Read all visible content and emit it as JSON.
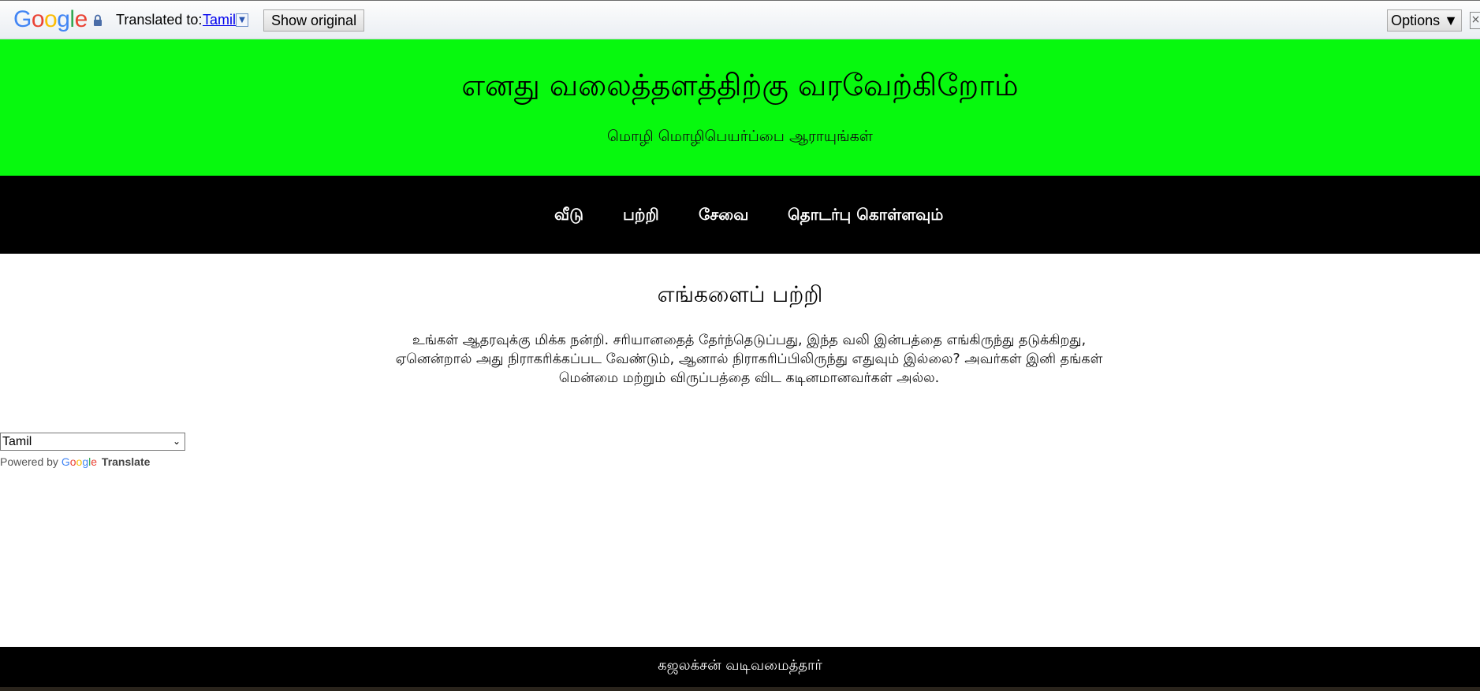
{
  "translate_bar": {
    "logo_letters": [
      "G",
      "o",
      "o",
      "g",
      "l",
      "e"
    ],
    "translated_to_label": "Translated to:",
    "language": "Tamil",
    "show_original_label": "Show original",
    "options_label": "Options ▼",
    "close_glyph": "×"
  },
  "header": {
    "title": "எனது வலைத்தளத்திற்கு வரவேற்கிறோம்",
    "subtitle": "மொழி மொழிபெயர்ப்பை ஆராயுங்கள்"
  },
  "nav": {
    "items": [
      "வீடு",
      "பற்றி",
      "சேவை",
      "தொடர்பு கொள்ளவும்"
    ]
  },
  "about": {
    "title": "எங்களைப் பற்றி",
    "text": "உங்கள் ஆதரவுக்கு மிக்க நன்றி. சரியானதைத் தேர்ந்தெடுப்பது, இந்த வலி இன்பத்தை எங்கிருந்து தடுக்கிறது, ஏனென்றால் அது நிராகரிக்கப்பட வேண்டும், ஆனால் நிராகரிப்பிலிருந்து எதுவும் இல்லை? அவர்கள் இனி தங்கள் மென்மை மற்றும் விருப்பத்தை விட கடினமானவர்கள் அல்ல."
  },
  "translate_widget": {
    "selected_language": "Tamil",
    "powered_by": "Powered by",
    "google": "Google",
    "translate": "Translate"
  },
  "footer": {
    "text": "கஜலக்சன் வடிவமைத்தார்"
  },
  "colors": {
    "header_bg": "#07f90e",
    "nav_bg": "#000000",
    "footer_bg": "#000000"
  }
}
